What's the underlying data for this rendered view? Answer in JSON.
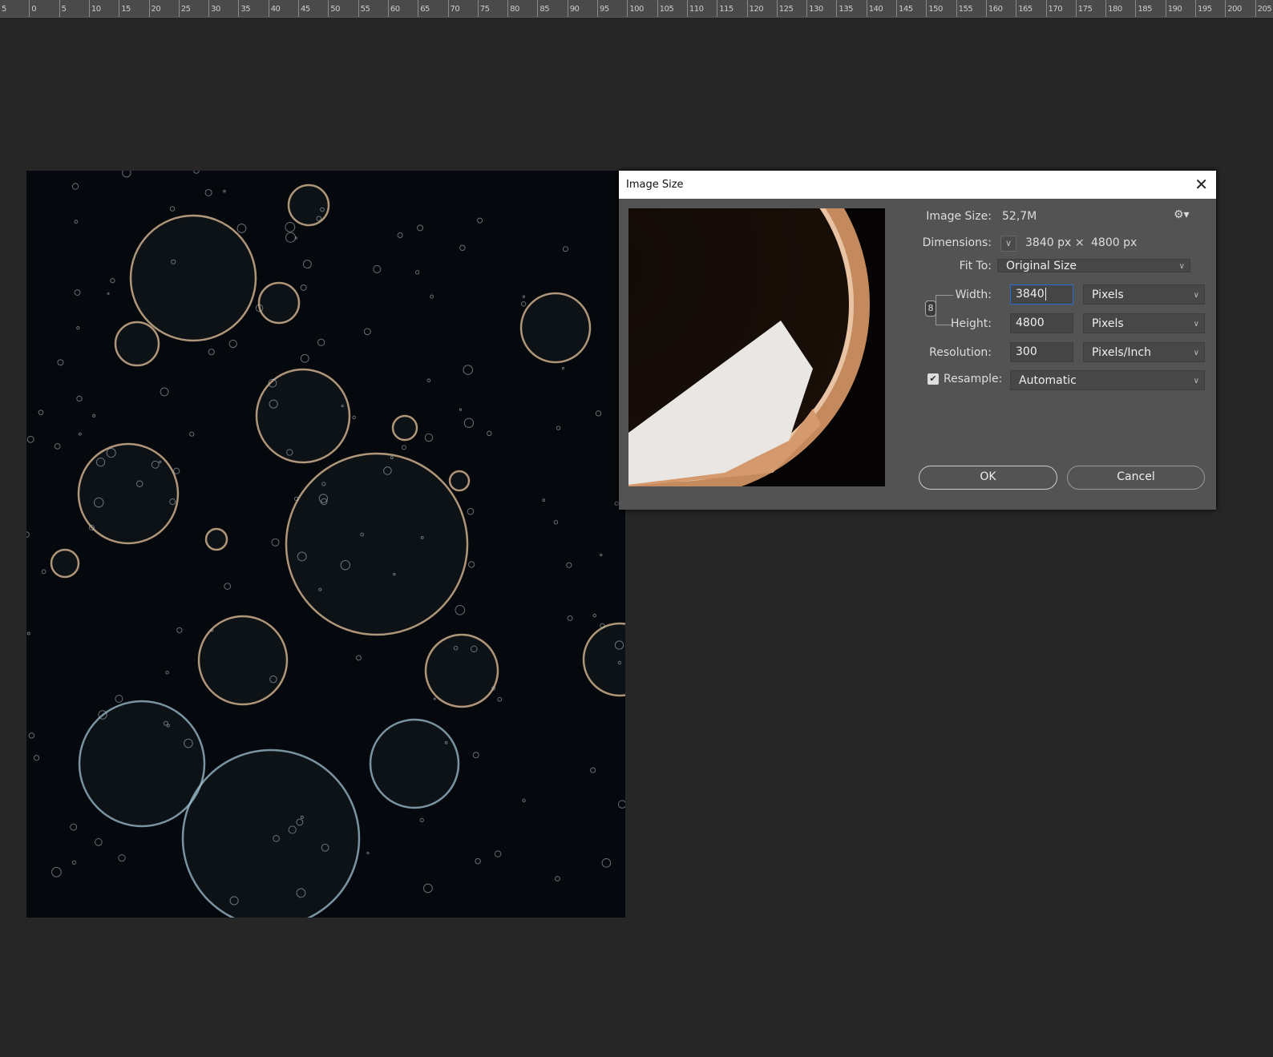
{
  "ruler": {
    "labels": [
      "5",
      "0",
      "5",
      "10",
      "15",
      "20",
      "25",
      "30",
      "35",
      "40",
      "45",
      "50",
      "55",
      "60",
      "65",
      "70",
      "75",
      "80",
      "85",
      "90",
      "95",
      "100",
      "105",
      "110",
      "115",
      "120",
      "125",
      "130",
      "135",
      "140",
      "145",
      "150",
      "155",
      "160",
      "165",
      "170",
      "175",
      "180",
      "185",
      "190",
      "195",
      "200",
      "205"
    ]
  },
  "dialog": {
    "title": "Image Size",
    "image_size_label": "Image Size:",
    "image_size_value": "52,7M",
    "dimensions_label": "Dimensions:",
    "dim_width": "3840 px",
    "dim_times": "×",
    "dim_height": "4800 px",
    "fit_to_label": "Fit To:",
    "fit_to_value": "Original Size",
    "width_label": "Width:",
    "width_value": "3840",
    "width_unit": "Pixels",
    "height_label": "Height:",
    "height_value": "4800",
    "height_unit": "Pixels",
    "resolution_label": "Resolution:",
    "resolution_value": "300",
    "resolution_unit": "Pixels/Inch",
    "resample_label": "Resample:",
    "resample_checked": true,
    "resample_value": "Automatic",
    "ok_label": "OK",
    "cancel_label": "Cancel"
  },
  "colors": {
    "focus": "#2a6bd1",
    "dialog_bg": "#535353",
    "workspace": "#262626"
  }
}
